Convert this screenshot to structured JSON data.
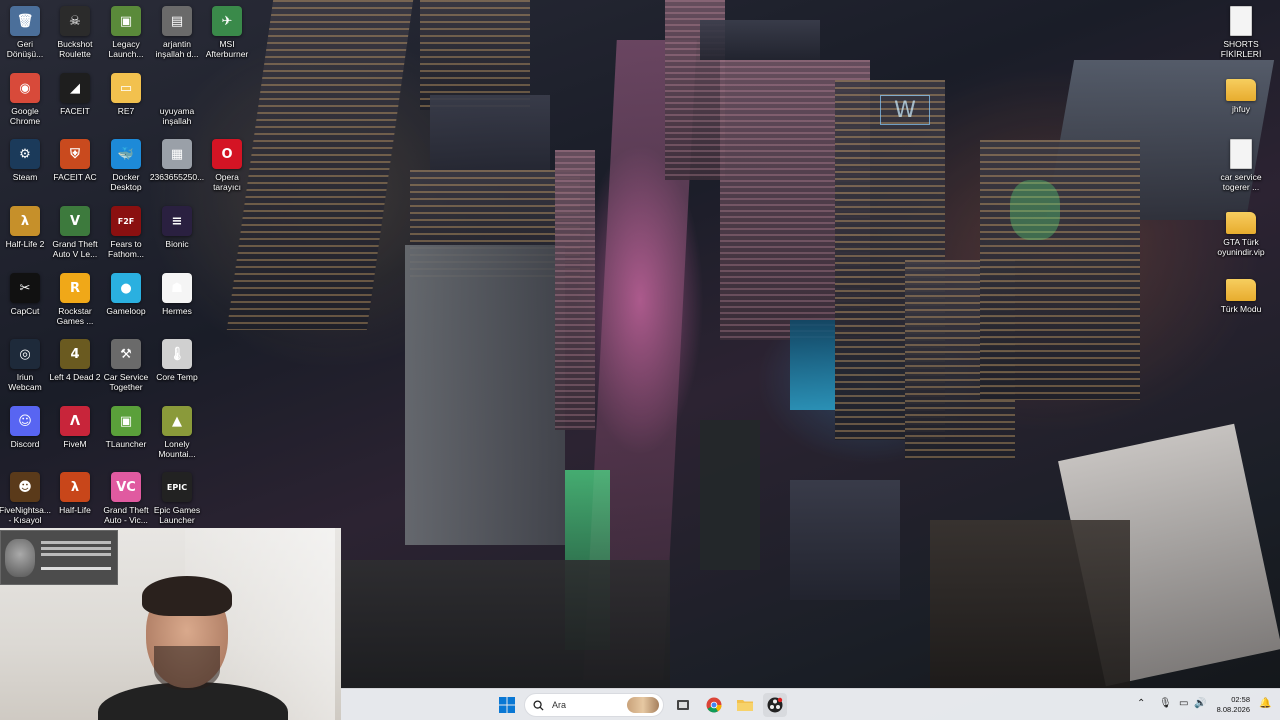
{
  "desktop": {
    "left_icons": [
      {
        "label": "Geri\nDönüşü...",
        "glyph": "🗑",
        "icon": "recycle-bin-icon",
        "color": "#4b6f9a"
      },
      {
        "label": "Buckshot\nRoulette",
        "glyph": "☠",
        "icon": "buckshot-roulette-icon",
        "color": "#2b2b2b"
      },
      {
        "label": "Legacy\nLaunch...",
        "glyph": "▣",
        "icon": "legacy-launcher-icon",
        "color": "#5a8a3a"
      },
      {
        "label": "arjantin\ninşallah d...",
        "glyph": "▤",
        "icon": "document-thumbnail-icon",
        "color": "#6a6a6a"
      },
      {
        "label": "MSI\nAfterburner",
        "glyph": "✈",
        "icon": "msi-afterburner-icon",
        "color": "#3a8a4a"
      },
      {
        "label": "Google\nChrome",
        "glyph": "◉",
        "icon": "chrome-icon",
        "color": "#d84a3a"
      },
      {
        "label": "FACEIT",
        "glyph": "◢",
        "icon": "faceit-icon",
        "color": "#1e1e1e"
      },
      {
        "label": "RE7",
        "glyph": "▭",
        "icon": "folder-icon",
        "color": "#f2c14e"
      },
      {
        "label": "uyuyama\ninşallah",
        "glyph": "",
        "icon": "blank-file-icon",
        "color": "transparent"
      },
      {
        "label": "",
        "glyph": "",
        "icon": "empty-slot",
        "color": "transparent"
      },
      {
        "label": "Steam",
        "glyph": "⚙",
        "icon": "steam-icon",
        "color": "#1b3a5a"
      },
      {
        "label": "FACEIT AC",
        "glyph": "⛨",
        "icon": "faceit-ac-icon",
        "color": "#c94a1e"
      },
      {
        "label": "Docker\nDesktop",
        "glyph": "🐳",
        "icon": "docker-icon",
        "color": "#1d8ad8"
      },
      {
        "label": "2363655250...",
        "glyph": "▦",
        "icon": "image-file-icon",
        "color": "#9aa0a8"
      },
      {
        "label": "Opera\ntarayıcı",
        "glyph": "O",
        "icon": "opera-icon",
        "color": "#d41424"
      },
      {
        "label": "Half-Life 2",
        "glyph": "λ",
        "icon": "half-life-2-icon",
        "color": "#c6902a"
      },
      {
        "label": "Grand Theft\nAuto V Le...",
        "glyph": "V",
        "icon": "gta-v-icon",
        "color": "#3d7a3d"
      },
      {
        "label": "Fears to\nFathom...",
        "glyph": "F2F",
        "icon": "fears-to-fathom-icon",
        "color": "#8a1010"
      },
      {
        "label": "Bionic",
        "glyph": "≡",
        "icon": "bionic-icon",
        "color": "#2a2040"
      },
      {
        "label": "",
        "glyph": "",
        "icon": "empty-slot",
        "color": "transparent"
      },
      {
        "label": "CapCut",
        "glyph": "✂",
        "icon": "capcut-icon",
        "color": "#111"
      },
      {
        "label": "Rockstar\nGames ...",
        "glyph": "R",
        "icon": "rockstar-icon",
        "color": "#f0a818"
      },
      {
        "label": "Gameloop",
        "glyph": "●",
        "icon": "gameloop-icon",
        "color": "#2ab0e0"
      },
      {
        "label": "Hermes",
        "glyph": "☗",
        "icon": "hermes-icon",
        "color": "#f5f5f5"
      },
      {
        "label": "",
        "glyph": "",
        "icon": "empty-slot",
        "color": "transparent"
      },
      {
        "label": "Iriun\nWebcam",
        "glyph": "◎",
        "icon": "iriun-webcam-icon",
        "color": "#1e2a3a"
      },
      {
        "label": "Left 4 Dead 2",
        "glyph": "4",
        "icon": "left-4-dead-2-icon",
        "color": "#6a5a20"
      },
      {
        "label": "Car Service\nTogether",
        "glyph": "⚒",
        "icon": "car-service-together-icon",
        "color": "#6a6a6a"
      },
      {
        "label": "Core Temp",
        "glyph": "🌡",
        "icon": "core-temp-icon",
        "color": "#d0d0d0"
      },
      {
        "label": "",
        "glyph": "",
        "icon": "empty-slot",
        "color": "transparent"
      },
      {
        "label": "Discord",
        "glyph": "☺",
        "icon": "discord-icon",
        "color": "#5865f2"
      },
      {
        "label": "FiveM",
        "glyph": "Λ",
        "icon": "fivem-icon",
        "color": "#c8253a"
      },
      {
        "label": "TLauncher",
        "glyph": "▣",
        "icon": "tlauncher-icon",
        "color": "#5aa03a"
      },
      {
        "label": "Lonely\nMountai...",
        "glyph": "▲",
        "icon": "lonely-mountains-icon",
        "color": "#8a9a3a"
      },
      {
        "label": "",
        "glyph": "",
        "icon": "empty-slot",
        "color": "transparent"
      },
      {
        "label": "FiveNightsa...\n- Kısayol",
        "glyph": "☻",
        "icon": "five-nights-icon",
        "color": "#5a3a1a"
      },
      {
        "label": "Half-Life",
        "glyph": "λ",
        "icon": "half-life-icon",
        "color": "#c8461a"
      },
      {
        "label": "Grand Theft\nAuto - Vic...",
        "glyph": "VC",
        "icon": "gta-vice-city-icon",
        "color": "#e05aa0"
      },
      {
        "label": "Epic Games\nLauncher",
        "glyph": "EPIC",
        "icon": "epic-games-icon",
        "color": "#222"
      }
    ],
    "right_icons": [
      {
        "label": "SHORTS\nFİKİRLERİ",
        "icon": "text-file-icon",
        "color": "#f4f4f4"
      },
      {
        "label": "jhfuy",
        "icon": "folder-icon",
        "color": "#f2c14e"
      },
      {
        "label": "car service\ntogerer ...",
        "icon": "text-file-icon",
        "color": "#f4f4f4"
      },
      {
        "label": "GTA Türk\noyunindir.vip",
        "icon": "folder-icon",
        "color": "#f2c14e"
      },
      {
        "label": "Türk Modu",
        "icon": "folder-icon",
        "color": "#f2c14e"
      }
    ]
  },
  "taskbar": {
    "search_placeholder": "Ara",
    "time": "02:58",
    "date": "8.08.2026"
  }
}
